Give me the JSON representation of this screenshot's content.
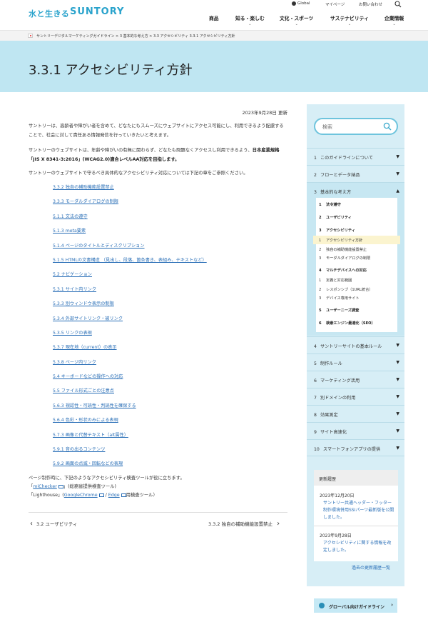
{
  "header": {
    "logo_jp": "水と生きる",
    "logo_en": "SUNTORY",
    "util": {
      "global": "Global",
      "mypage": "マイページ",
      "contact": "お問い合わせ"
    },
    "nav": [
      {
        "label": "商品",
        "has_menu": false
      },
      {
        "label": "知る・楽しむ",
        "has_menu": true
      },
      {
        "label": "文化・スポーツ",
        "has_menu": true
      },
      {
        "label": "サステナビリティ",
        "has_menu": true
      },
      {
        "label": "企業情報",
        "has_menu": true
      }
    ],
    "chevron": "⌄"
  },
  "breadcrumb": "サントリーデジタルマーケティングガイドライン  >  3 基本的な考え方  >  3.3 アクセシビリティ  3.3.1 アクセシビリティ方針",
  "page_title": "3.3.1 アクセシビリティ方針",
  "date": "2023年9月28日 更新",
  "intro": {
    "p1": "サントリーは、高齢者や障がい者を含めて、どなたにもスムーズにウェブサイトにアクセス可能にし、利用できるよう配慮することで、社会に対して責任ある情報発信を行っていきたいと考えます。",
    "p2_a": "サントリーのウェブサイトは、年齢や障がいの有無に関わらず、どなたも問題なくアクセスし利用できるよう、",
    "p2_b": "日本産業規格「JIS X 8341-3:2016」(WCAG2.0)適合レベルAA対応を目指します。",
    "p3": "サントリーのウェブサイトで守るべき具体的なアクセシビリティ対応については下記の章をご参照ください。"
  },
  "links": [
    "3.3.2 独自の補助機能設置禁止",
    "3.3.3 モーダルダイアログの制限",
    "5.1.1 文法の遵守",
    "5.1.3 meta要素",
    "5.1.4 ページのタイトルとディスクリプション",
    "5.1.5 HTMLの文書構造 （見出し、段落、箇条書き、表組み、テキストなど）",
    "5.2 ナビゲーション",
    "5.3.1 サイト内リンク",
    "5.3.3 別ウィンドウ表示の制限",
    "5.3.4 外部サイトリンク・被リンク",
    "5.3.5 リンクの表現",
    "5.3.7 現在地（current）の表示",
    "5.3.8 ページ内リンク",
    "5.4 キーボードなどの操作への対応",
    "5.5 ファイル形式ごとの注意点",
    "5.6.3 視認性・可読性・判読性を確保する",
    "5.6.4 色彩・形状のみによる表現",
    "5.7.3 画像と代替テキスト（alt属性）",
    "5.9.1 音の出るコンテンツ",
    "5.9.2 画面の点滅・回転などの表現"
  ],
  "tools": {
    "lead": "ページ制作時に、下記のようなアクセシビリティ検査ツールが役に立ちます。",
    "t1_open": "「",
    "t1_link": "miChecker",
    "t1_rest": "」(総務省提供検査ツール)",
    "t2_open": "「Lighthouse」(",
    "t2_link1": "GoogleChrome",
    "t2_sep": " / ",
    "t2_link2": "Edge",
    "t2_rest": "用検査ツール）"
  },
  "pager": {
    "prev": "3.2 ユーザビリティ",
    "next": "3.3.2 独自の補助機能設置禁止",
    "prev_arrow": "‹",
    "next_arrow": "›"
  },
  "sidebar": {
    "search_placeholder": "検索",
    "nav_top": [
      {
        "num": "1",
        "label": "このガイドラインについて"
      },
      {
        "num": "2",
        "label": "フローとデータ納品"
      },
      {
        "num": "3",
        "label": "基本的な考え方"
      }
    ],
    "sub": [
      {
        "num": "1",
        "label": "法令遵守",
        "bold": true
      },
      {
        "num": "2",
        "label": "ユーザビリティ",
        "bold": true
      },
      {
        "num": "3",
        "label": "アクセシビリティ",
        "bold": true
      },
      {
        "num": "1",
        "label": "アクセシビリティ方針",
        "bold": false,
        "active": true
      },
      {
        "num": "2",
        "label": "独自の補助機能設置禁止",
        "bold": false
      },
      {
        "num": "3",
        "label": "モーダルダイアログの制限",
        "bold": false
      },
      {
        "num": "4",
        "label": "マルチデバイスへの対応",
        "bold": true
      },
      {
        "num": "1",
        "label": "定義と対応範囲",
        "bold": false
      },
      {
        "num": "2",
        "label": "レスポンシブ（1URL統合）",
        "bold": false
      },
      {
        "num": "3",
        "label": "デバイス専用サイト",
        "bold": false
      },
      {
        "num": "5",
        "label": "ユーザーニーズ調査",
        "bold": true
      },
      {
        "num": "6",
        "label": "検索エンジン最適化（SEO）",
        "bold": true
      }
    ],
    "nav_bottom": [
      {
        "num": "4",
        "label": "サントリーサイトの基本ルール"
      },
      {
        "num": "5",
        "label": "制作ルール"
      },
      {
        "num": "6",
        "label": "マーケティング活用"
      },
      {
        "num": "7",
        "label": "別ドメインの利用"
      },
      {
        "num": "8",
        "label": "効果測定"
      },
      {
        "num": "9",
        "label": "サイト高速化"
      },
      {
        "num": "10",
        "label": "スマートフォンアプリの提供"
      }
    ],
    "arrow_down": "▼",
    "arrow_up": "▲",
    "history": {
      "title": "更新履歴",
      "entries": [
        {
          "date": "2023年12月20日",
          "text": "サントリー共通ヘッダー・フッター制作環境併用SSIパーツ最新版を公開しました。"
        },
        {
          "date": "2023年9月28日",
          "text": "アクセシビリティに関する情報を改定しました。"
        }
      ],
      "more": "過去の更新履歴一覧"
    },
    "global_btn": "グローバル向けガイドライン",
    "global_arrow": "›"
  },
  "colors": {
    "accent": "#2aa3cc",
    "hero": "#bfe6f2",
    "sidebar": "#d7eef6",
    "link": "#2a6fb7"
  }
}
